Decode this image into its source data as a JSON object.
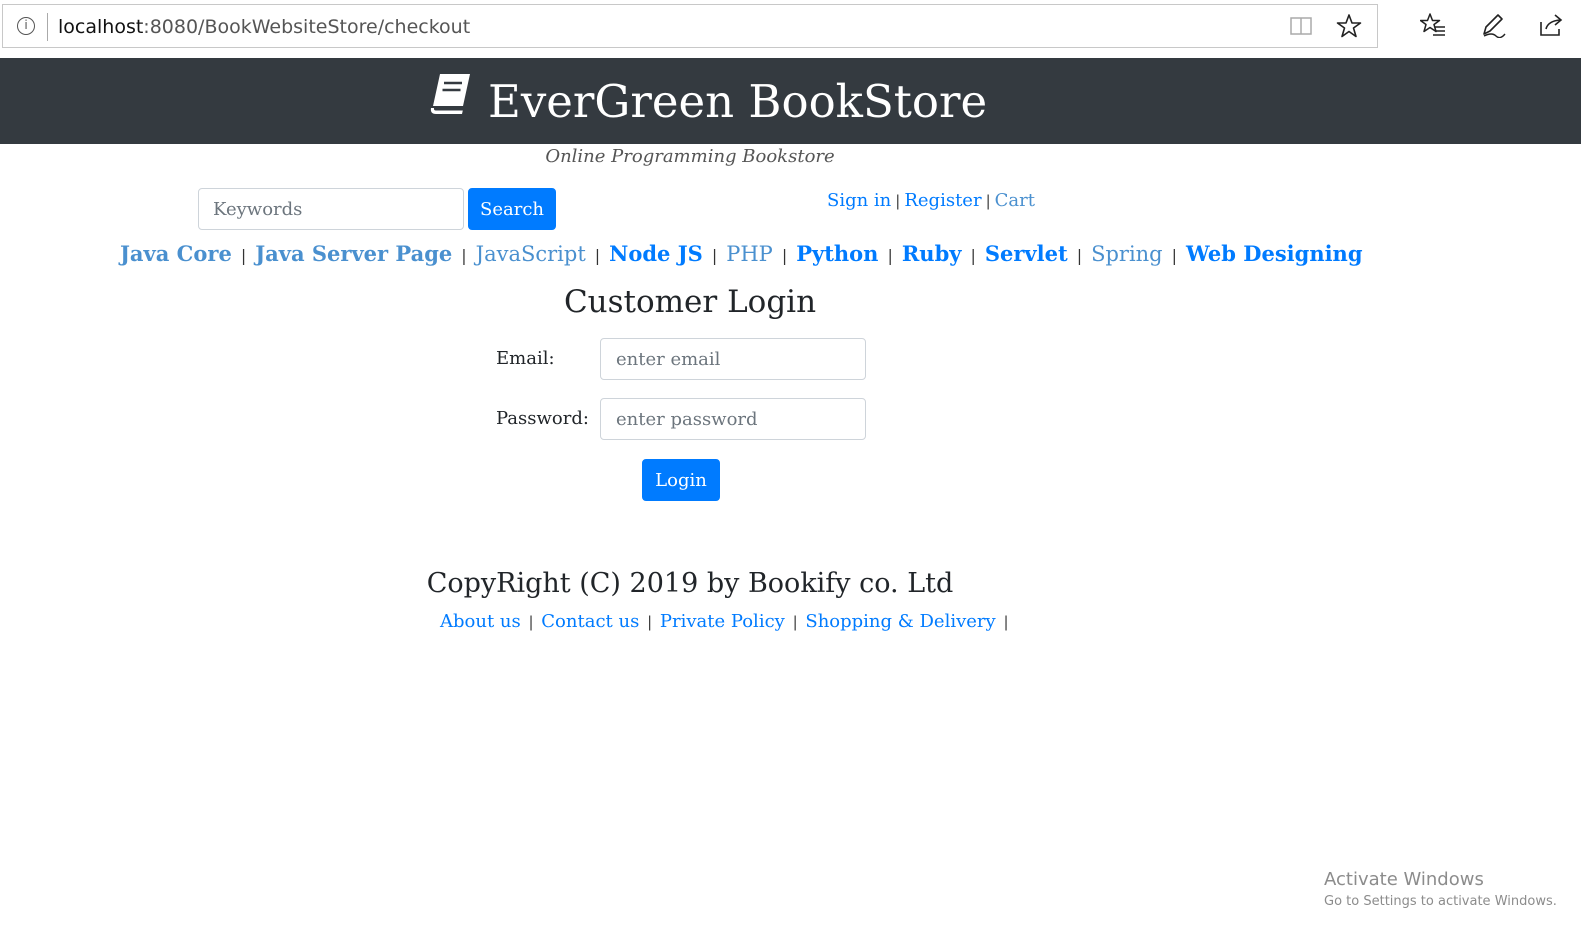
{
  "browser": {
    "url_host": "localhost",
    "url_path": ":8080/BookWebsiteStore/checkout",
    "icons": [
      "info-icon",
      "reading-view-icon",
      "favorite-star-icon",
      "favorites-list-icon",
      "pen-icon",
      "share-icon"
    ]
  },
  "header": {
    "title": "EverGreen BookStore",
    "logo_icon": "book-icon",
    "tagline": "Online Programming Bookstore",
    "background": "#343a40"
  },
  "search": {
    "placeholder": "Keywords",
    "button_label": "Search"
  },
  "account_links": {
    "sign_in": "Sign in",
    "register": "Register",
    "cart": "Cart",
    "separator": "|"
  },
  "categories": [
    {
      "label": "Java Core"
    },
    {
      "label": "Java Server Page"
    },
    {
      "label": "JavaScript"
    },
    {
      "label": "Node JS"
    },
    {
      "label": "PHP"
    },
    {
      "label": "Python"
    },
    {
      "label": "Ruby"
    },
    {
      "label": "Servlet"
    },
    {
      "label": "Spring"
    },
    {
      "label": "Web Designing"
    }
  ],
  "login": {
    "title": "Customer Login",
    "email_label": "Email:",
    "email_placeholder": "enter email",
    "password_label": "Password:",
    "password_placeholder": "enter password",
    "button_label": "Login"
  },
  "footer": {
    "copyright": "CopyRight (C) 2019 by Bookify co. Ltd",
    "links": {
      "about": "About us",
      "contact": "Contact us",
      "privacy": "Private Policy",
      "shipping": "Shopping & Delivery"
    },
    "separator": "|"
  },
  "watermark": {
    "title": "Activate Windows",
    "subtitle": "Go to Settings to activate Windows."
  },
  "colors": {
    "primary": "#007bff",
    "visited_link": "#4a90cf",
    "text": "#212529"
  }
}
